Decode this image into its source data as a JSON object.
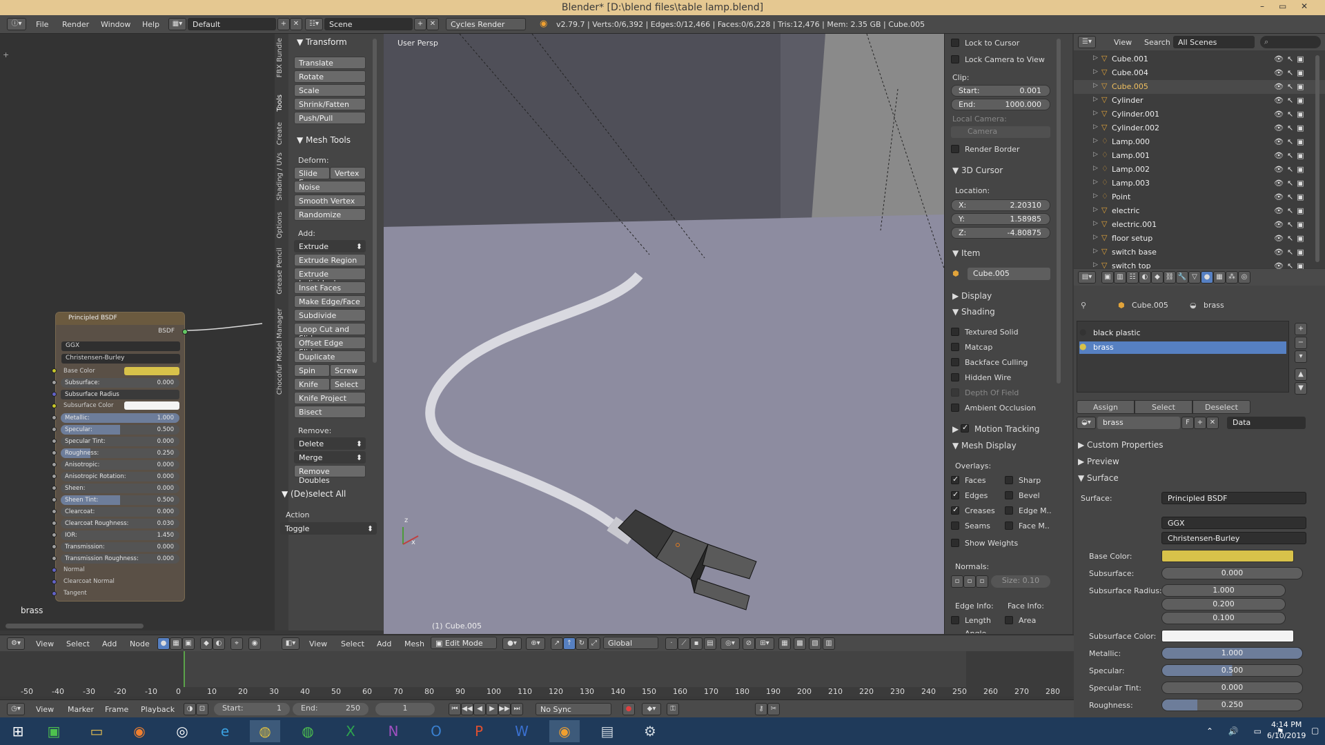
{
  "window": {
    "title": "Blender* [D:\\blend files\\table lamp.blend]",
    "min": "–",
    "max": "▭",
    "close": "✕"
  },
  "menus": [
    "File",
    "Render",
    "Window",
    "Help"
  ],
  "layout": "Default",
  "scene": "Scene",
  "engine": "Cycles Render",
  "stats": "v2.79.7 | Verts:0/6,392 | Edges:0/12,466 | Faces:0/6,228 | Tris:12,476 | Mem: 2.35 GB | Cube.005",
  "node": {
    "title": "Principled BSDF",
    "output": "BSDF",
    "distribution": "GGX",
    "sss": "Christensen-Burley",
    "inputs": [
      {
        "l": "Base Color",
        "v": ""
      },
      {
        "l": "Subsurface:",
        "v": "0.000"
      },
      {
        "l": "Subsurface Radius",
        "v": ""
      },
      {
        "l": "Subsurface Color",
        "v": ""
      },
      {
        "l": "Metallic:",
        "v": "1.000"
      },
      {
        "l": "Specular:",
        "v": "0.500"
      },
      {
        "l": "Specular Tint:",
        "v": "0.000"
      },
      {
        "l": "Roughness:",
        "v": "0.250"
      },
      {
        "l": "Anisotropic:",
        "v": "0.000"
      },
      {
        "l": "Anisotropic Rotation:",
        "v": "0.000"
      },
      {
        "l": "Sheen:",
        "v": "0.000"
      },
      {
        "l": "Sheen Tint:",
        "v": "0.500"
      },
      {
        "l": "Clearcoat:",
        "v": "0.000"
      },
      {
        "l": "Clearcoat Roughness:",
        "v": "0.030"
      },
      {
        "l": "IOR:",
        "v": "1.450"
      },
      {
        "l": "Transmission:",
        "v": "0.000"
      },
      {
        "l": "Transmission Roughness:",
        "v": "0.000"
      }
    ],
    "vectors": [
      "Normal",
      "Clearcoat Normal",
      "Tangent"
    ],
    "base_color": "#d8c24a",
    "material_label": "brass"
  },
  "node_header": {
    "menus": [
      "View",
      "Select",
      "Add",
      "Node"
    ]
  },
  "vtabs": [
    "FBX Bundle",
    "Tools",
    "Create",
    "Shading / UVs",
    "Options",
    "Grease Pencil",
    "Chocofur Model Manager"
  ],
  "tools": {
    "transform": "Transform",
    "transform_btns": [
      "Translate",
      "Rotate",
      "Scale",
      "Shrink/Fatten",
      "Push/Pull"
    ],
    "mesh_tools": "Mesh Tools",
    "deform": "Deform:",
    "slide": "Slide E..",
    "vertex": "Vertex",
    "deform_btns": [
      "Noise",
      "Smooth Vertex",
      "Randomize"
    ],
    "add": "Add:",
    "extrude": "Extrude",
    "add_btns": [
      "Extrude Region",
      "Extrude Individual",
      "Inset Faces",
      "Make Edge/Face",
      "Subdivide",
      "Loop Cut and Slide",
      "Offset Edge Slide",
      "Duplicate"
    ],
    "spin": "Spin",
    "screw": "Screw",
    "knife": "Knife",
    "select": "Select",
    "knife_project": "Knife Project",
    "bisect": "Bisect",
    "remove": "Remove:",
    "delete": "Delete",
    "merge": "Merge",
    "remove_doubles": "Remove Doubles",
    "deselect_all": "(De)select All",
    "action": "Action",
    "toggle": "Toggle"
  },
  "viewport": {
    "label": "User Persp",
    "object": "(1) Cube.005",
    "axis_z": "z",
    "axis_x": "x",
    "header": {
      "menus": [
        "View",
        "Select",
        "Add",
        "Mesh"
      ],
      "mode": "Edit Mode",
      "orientation": "Global"
    }
  },
  "npanel": {
    "lock_cursor": "Lock to Cursor",
    "lock_camera": "Lock Camera to View",
    "clip": "Clip:",
    "start_l": "Start:",
    "start_v": "0.001",
    "end_l": "End:",
    "end_v": "1000.000",
    "local_camera": "Local Camera:",
    "camera": "Camera",
    "render_border": "Render Border",
    "cursor3d": "3D Cursor",
    "location": "Location:",
    "x_l": "X:",
    "x_v": "2.20310",
    "y_l": "Y:",
    "y_v": "1.58985",
    "z_l": "Z:",
    "z_v": "-4.80875",
    "item": "Item",
    "item_name": "Cube.005",
    "display": "Display",
    "shading": "Shading",
    "shading_opts": [
      "Textured Solid",
      "Matcap",
      "Backface Culling",
      "Hidden Wire",
      "Depth Of Field",
      "Ambient Occlusion"
    ],
    "motion": "Motion Tracking",
    "mesh_display": "Mesh Display",
    "overlays": "Overlays:",
    "ov_left": [
      "Faces",
      "Edges",
      "Creases",
      "Seams"
    ],
    "ov_right": [
      "Sharp",
      "Bevel",
      "Edge M..",
      "Face M.."
    ],
    "show_weights": "Show Weights",
    "normals": "Normals:",
    "size": "Size:  0.10",
    "edge_info": "Edge Info:",
    "face_info": "Face Info:",
    "length": "Length",
    "area": "Area",
    "angle": "Angle"
  },
  "outliner": {
    "menus": [
      "View",
      "Search"
    ],
    "scenes": "All Scenes",
    "items": [
      "Cube.001",
      "Cube.004",
      "Cube.005",
      "Cylinder",
      "Cylinder.001",
      "Cylinder.002",
      "Lamp.000",
      "Lamp.001",
      "Lamp.002",
      "Lamp.003",
      "Point",
      "electric",
      "electric.001",
      "floor setup",
      "switch base",
      "switch top"
    ]
  },
  "props": {
    "object": "Cube.005",
    "material": "brass",
    "slots": [
      "black plastic",
      "brass"
    ],
    "assign": "Assign",
    "select": "Select",
    "deselect": "Deselect",
    "mat_name": "brass",
    "f": "F",
    "data": "Data",
    "custom": "Custom Properties",
    "preview": "Preview",
    "surface_hdr": "Surface",
    "surface_l": "Surface:",
    "surface_v": "Principled BSDF",
    "ggx": "GGX",
    "cb": "Christensen-Burley",
    "base_color_l": "Base Color:",
    "subsurface_l": "Subsurface:",
    "subsurface_v": "0.000",
    "radius_l": "Subsurface Radius:",
    "r1": "1.000",
    "r2": "0.200",
    "r3": "0.100",
    "sscolor_l": "Subsurface Color:",
    "metallic_l": "Metallic:",
    "metallic_v": "1.000",
    "specular_l": "Specular:",
    "specular_v": "0.500",
    "spectint_l": "Specular Tint:",
    "spectint_v": "0.000",
    "rough_l": "Roughness:",
    "rough_v": "0.250"
  },
  "timeline": {
    "ticks": [
      "-50",
      "-40",
      "-30",
      "-20",
      "-10",
      "0",
      "10",
      "20",
      "30",
      "40",
      "50",
      "60",
      "70",
      "80",
      "90",
      "100",
      "110",
      "120",
      "130",
      "140",
      "150",
      "160",
      "170",
      "180",
      "190",
      "200",
      "210",
      "220",
      "230",
      "240",
      "250",
      "260",
      "270",
      "280"
    ],
    "menus": [
      "View",
      "Marker",
      "Frame",
      "Playback"
    ],
    "start_l": "Start:",
    "start_v": "1",
    "end_l": "End:",
    "end_v": "250",
    "frame": "1",
    "sync": "No Sync"
  },
  "taskbar": {
    "time": "4:14 PM",
    "date": "6/10/2019"
  }
}
